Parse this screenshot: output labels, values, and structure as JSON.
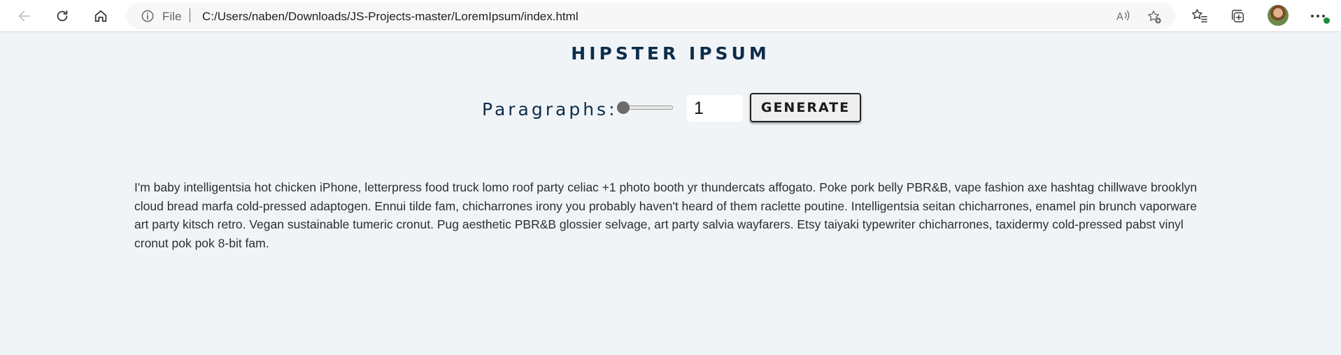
{
  "browser": {
    "address_scheme": "File",
    "address_url": "C:/Users/naben/Downloads/JS-Projects-master/LoremIpsum/index.html",
    "icons": {
      "back": "back-arrow-icon",
      "reload": "reload-icon",
      "home": "home-icon",
      "info": "info-icon",
      "read_aloud": "read-aloud-icon",
      "add_favorite": "add-favorite-icon",
      "favorites": "favorites-icon",
      "collections": "collections-icon",
      "profile": "avatar",
      "menu": "more-menu-icon"
    },
    "colors": {
      "toolbar_bg": "#ffffff",
      "address_bg": "#f7f7f7",
      "notification_dot": "#1f8a3a"
    }
  },
  "page": {
    "title": "HIPSTER IPSUM",
    "paragraphs_label": "Paragraphs:",
    "slider": {
      "min": 1,
      "max": 10,
      "value": 1
    },
    "count_value": "1",
    "generate_label": "GENERATE",
    "paragraphs": [
      "I'm baby intelligentsia hot chicken iPhone, letterpress food truck lomo roof party celiac +1 photo booth yr thundercats affogato. Poke pork belly PBR&B, vape fashion axe hashtag chillwave brooklyn cloud bread marfa cold-pressed adaptogen. Ennui tilde fam, chicharrones irony you probably haven't heard of them raclette poutine. Intelligentsia seitan chicharrones, enamel pin brunch vaporware art party kitsch retro. Vegan sustainable tumeric cronut. Pug aesthetic PBR&B glossier selvage, art party salvia wayfarers. Etsy taiyaki typewriter chicharrones, taxidermy cold-pressed pabst vinyl cronut pok pok 8-bit fam."
    ],
    "colors": {
      "background": "#f1f4f7",
      "heading": "#0c2d4a",
      "body_text": "#2a2e33"
    }
  }
}
